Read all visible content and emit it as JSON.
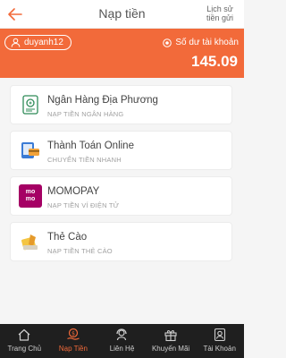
{
  "header": {
    "title": "Nạp tiền",
    "history_line1": "Lịch sử",
    "history_line2": "tiền gửi"
  },
  "account": {
    "username": "duyanh12",
    "balance_label": "Số dư tài khoản",
    "balance": "145.09"
  },
  "methods": [
    {
      "name": "Ngân Hàng Địa Phương",
      "subtitle": "NẠP TIỀN NGÂN HÀNG",
      "icon": "bank-icon"
    },
    {
      "name": "Thành Toán Online",
      "subtitle": "CHUYỂN TIỀN NHANH",
      "icon": "online-payment-icon"
    },
    {
      "name": "MOMOPAY",
      "subtitle": "NẠP TIỀN VÍ ĐIỆN TỬ",
      "icon": "momo-icon",
      "logo_line1": "mo",
      "logo_line2": "mo"
    },
    {
      "name": "Thẻ Cào",
      "subtitle": "NẠP TIỀN THẺ CÀO",
      "icon": "scratch-card-icon"
    }
  ],
  "tabs": [
    {
      "label": "Trang Chủ",
      "icon": "home-icon"
    },
    {
      "label": "Nạp Tiền",
      "icon": "deposit-icon",
      "active": true
    },
    {
      "label": "Liên Hệ",
      "icon": "contact-icon"
    },
    {
      "label": "Khuyến Mãi",
      "icon": "gift-icon"
    },
    {
      "label": "Tài Khoản",
      "icon": "account-icon"
    }
  ],
  "colors": {
    "accent": "#f26a3a",
    "tabbar": "#1f1f1f",
    "momo": "#a50064"
  }
}
